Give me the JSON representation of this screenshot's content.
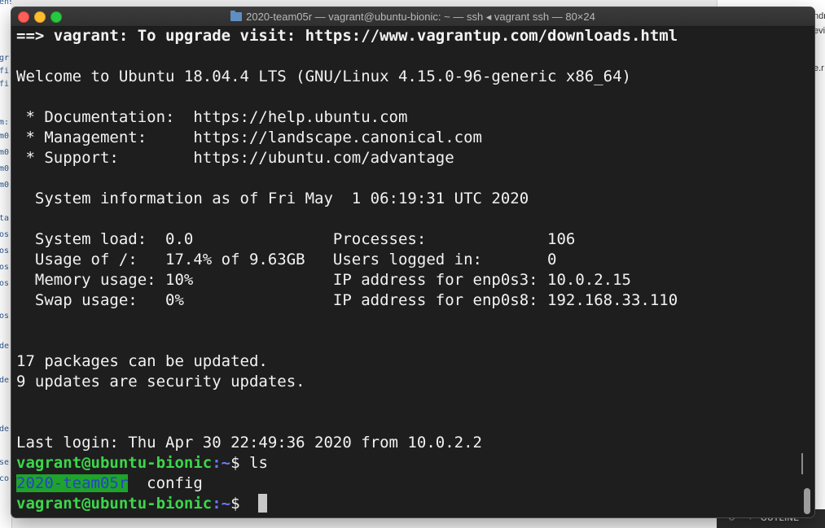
{
  "window": {
    "title": "2020-team05r — vagrant@ubuntu-bionic: ~ — ssh ◂ vagrant ssh — 80×24"
  },
  "background": {
    "left_fragments": [
      "ensions",
      "gr",
      "fi",
      "fi",
      "m:",
      "m0",
      "m0",
      "m0",
      "m0",
      "ta",
      "os",
      "os",
      "os",
      "os",
      "os",
      "de",
      "de",
      "de",
      "se",
      "co"
    ],
    "right_fragments": [
      "ndr",
      "evi",
      "e.r"
    ],
    "outline_label": "OUTLINE"
  },
  "terminal": {
    "lines": {
      "upgrade": "==> vagrant: To upgrade visit: https://www.vagrantup.com/downloads.html",
      "welcome": "Welcome to Ubuntu 18.04.4 LTS (GNU/Linux 4.15.0-96-generic x86_64)",
      "documentation": " * Documentation:  https://help.ubuntu.com",
      "management": " * Management:     https://landscape.canonical.com",
      "support": " * Support:        https://ubuntu.com/advantage",
      "sysinfo": "  System information as of Fri May  1 06:19:31 UTC 2020",
      "sysload": "  System load:  0.0               Processes:             106",
      "usage": "  Usage of /:   17.4% of 9.63GB   Users logged in:       0",
      "memory": "  Memory usage: 10%               IP address for enp0s3: 10.0.2.15",
      "swap": "  Swap usage:   0%                IP address for enp0s8: 192.168.33.110",
      "packages": "17 packages can be updated.",
      "security": "9 updates are security updates.",
      "last_login": "Last login: Thu Apr 30 22:49:36 2020 from 10.0.2.2"
    },
    "prompt": {
      "user_host": "vagrant@ubuntu-bionic",
      "path": ":~",
      "symbol": "$ ",
      "command": "ls"
    },
    "ls_output": {
      "dir": "2020-team05r",
      "file": "config"
    }
  }
}
